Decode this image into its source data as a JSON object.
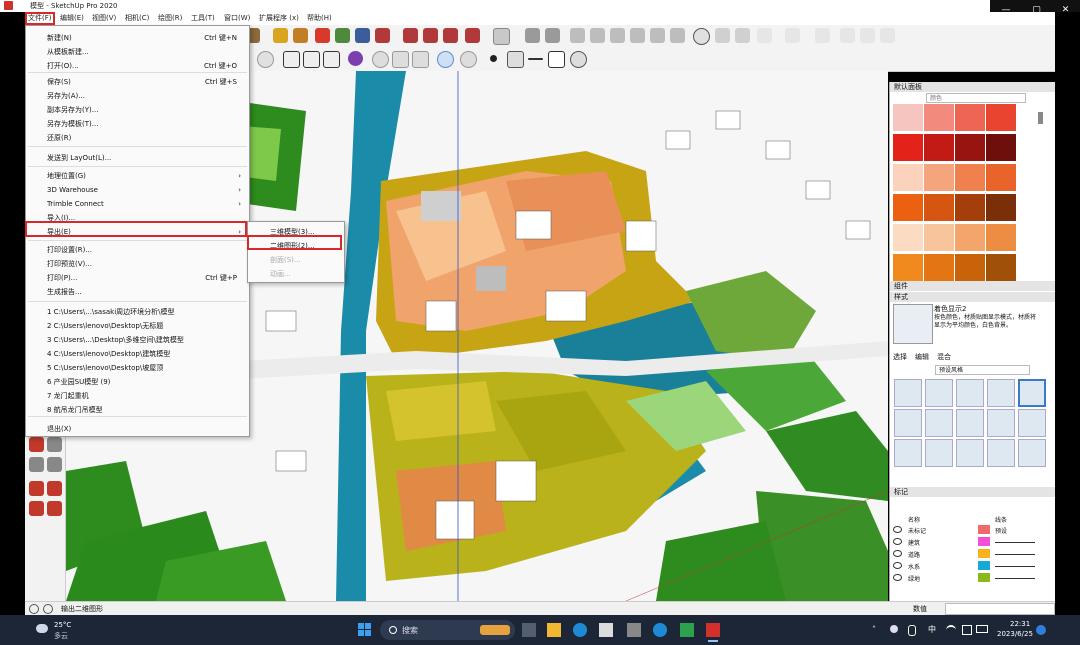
{
  "window": {
    "title": "模型 - SketchUp Pro 2020",
    "minimize": "—",
    "maximize": "▢",
    "close": "✕"
  },
  "menubar": [
    "文件(F)",
    "编辑(E)",
    "视图(V)",
    "相机(C)",
    "绘图(R)",
    "工具(T)",
    "窗口(W)",
    "扩展程序 (x)",
    "帮助(H)"
  ],
  "file_menu": {
    "items": [
      {
        "label": "新建(N)",
        "shortcut": "Ctrl 键+N"
      },
      {
        "label": "从模板新建...",
        "shortcut": ""
      },
      {
        "label": "打开(O)...",
        "shortcut": "Ctrl 键+O"
      },
      {
        "label": "保存(S)",
        "shortcut": "Ctrl 键+S"
      },
      {
        "label": "另存为(A)...",
        "shortcut": ""
      },
      {
        "label": "副本另存为(Y)...",
        "shortcut": ""
      },
      {
        "label": "另存为模板(T)...",
        "shortcut": ""
      },
      {
        "label": "还原(R)",
        "shortcut": ""
      },
      {
        "label": "发送到 LayOut(L)...",
        "shortcut": ""
      },
      {
        "label": "地理位置(G)",
        "shortcut": ""
      },
      {
        "label": "3D Warehouse",
        "shortcut": ""
      },
      {
        "label": "Trimble Connect",
        "shortcut": ""
      },
      {
        "label": "导入(I)...",
        "shortcut": ""
      },
      {
        "label": "导出(E)",
        "shortcut": ""
      },
      {
        "label": "打印设置(R)...",
        "shortcut": ""
      },
      {
        "label": "打印预览(V)...",
        "shortcut": ""
      },
      {
        "label": "打印(P)...",
        "shortcut": "Ctrl 键+P"
      },
      {
        "label": "生成报告...",
        "shortcut": ""
      },
      {
        "label": "1 C:\\Users\\...\\sasaki周边环境分析\\模型",
        "shortcut": ""
      },
      {
        "label": "2 C:\\Users\\lenovo\\Desktop\\无标题",
        "shortcut": ""
      },
      {
        "label": "3 C:\\Users\\...\\Desktop\\多维空间\\建筑模型",
        "shortcut": ""
      },
      {
        "label": "4 C:\\Users\\lenovo\\Desktop\\建筑模型",
        "shortcut": ""
      },
      {
        "label": "5 C:\\Users\\lenovo\\Desktop\\坡屋顶",
        "shortcut": ""
      },
      {
        "label": "6 产业园SU模型 (9)",
        "shortcut": ""
      },
      {
        "label": "7 龙门起重机",
        "shortcut": ""
      },
      {
        "label": "8 航吊龙门吊模型",
        "shortcut": ""
      },
      {
        "label": "退出(X)",
        "shortcut": ""
      }
    ],
    "arrow": "›"
  },
  "export_submenu": [
    "三维模型(3)...",
    "二维图形(2)...",
    "剖面(S)...",
    "动画..."
  ],
  "right_panel": {
    "default_tray": "默认面板",
    "materials_dropdown": "颜色",
    "components": "组件",
    "styles": "样式",
    "style_name": "着色显示2",
    "style_desc": "按色颜色，材质贴图显示模式，材质将显示为平均颜色，白色背景。",
    "style_tabs": [
      "选择",
      "编辑",
      "混合"
    ],
    "style_dropdown": "预设风格",
    "tags": "标记",
    "tags_header": [
      "名称",
      "",
      "线条"
    ],
    "tags_rows": [
      {
        "name": "未标记",
        "color": "#f06a6a",
        "line": "预设"
      },
      {
        "name": "建筑",
        "color": "#f04fd6",
        "line": ""
      },
      {
        "name": "道路",
        "color": "#f7b21c",
        "line": ""
      },
      {
        "name": "水系",
        "color": "#18a8d8",
        "line": ""
      },
      {
        "name": "绿地",
        "color": "#8db81a",
        "line": ""
      }
    ]
  },
  "swatch_colors": [
    "#f7c5c0",
    "#f28a7e",
    "#ef6554",
    "#e8442f",
    "#e3231a",
    "#c21a14",
    "#981410",
    "#6e0f0b",
    "#fbd3bd",
    "#f5a57e",
    "#f1804f",
    "#e9642a",
    "#ec6012",
    "#d55511",
    "#a43f0c",
    "#7b2f09",
    "#fbdcc2",
    "#f8c49b",
    "#f3a56c",
    "#ec8d43",
    "#f08a1f",
    "#e47514",
    "#c86309",
    "#a05107"
  ],
  "status": {
    "message": "输出二维图形",
    "measure_label": "数值"
  },
  "taskbar": {
    "weather_temp": "25°C",
    "weather_desc": "多云",
    "search_placeholder": "搜索",
    "ime": "中",
    "time": "22:31",
    "date": "2023/6/25"
  },
  "accent_red": "#d7282a"
}
